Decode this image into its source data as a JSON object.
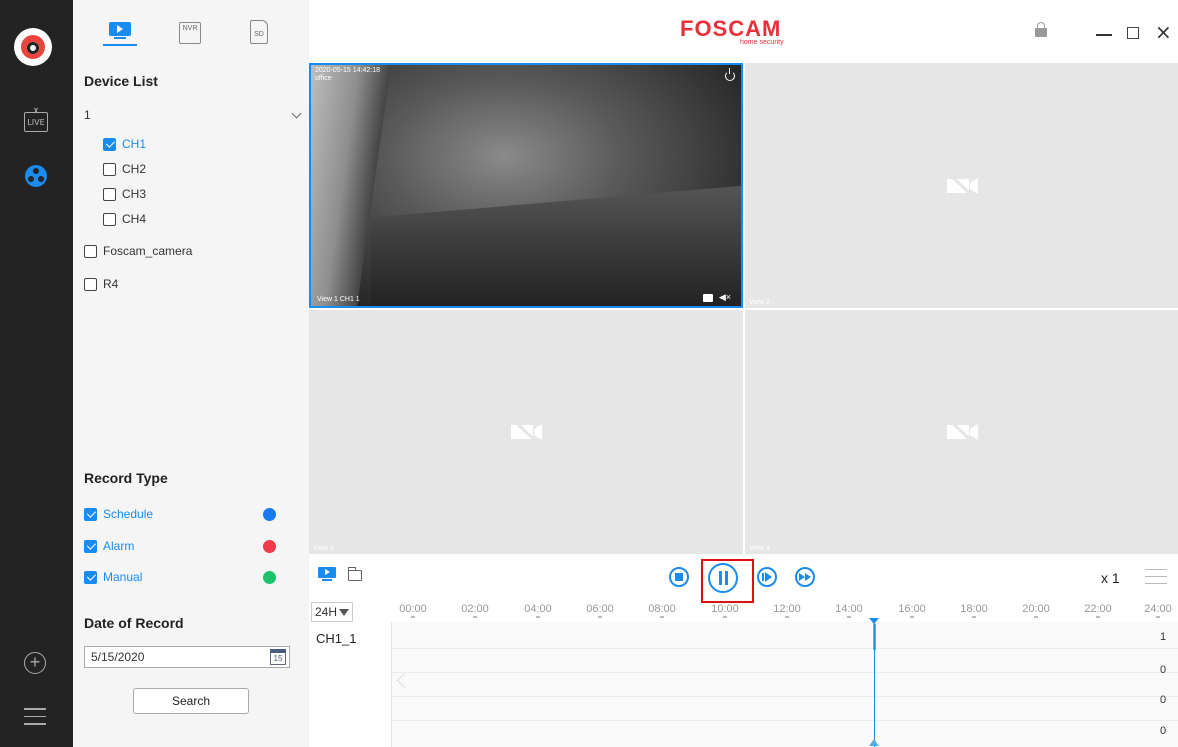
{
  "brand": {
    "name": "FOSCAM",
    "sub": "home security"
  },
  "side_tabs": {
    "nvr": "NVR",
    "sd": "SD"
  },
  "rail": {
    "live": "LIVE"
  },
  "device_list": {
    "title": "Device List",
    "selected_device": "1",
    "channels": [
      {
        "label": "CH1",
        "checked": true
      },
      {
        "label": "CH2",
        "checked": false
      },
      {
        "label": "CH3",
        "checked": false
      },
      {
        "label": "CH4",
        "checked": false
      }
    ],
    "others": [
      {
        "label": "Foscam_camera",
        "checked": false
      },
      {
        "label": "R4",
        "checked": false
      }
    ]
  },
  "record_type": {
    "title": "Record Type",
    "items": [
      {
        "label": "Schedule",
        "checked": true,
        "color": "#1a78f0"
      },
      {
        "label": "Alarm",
        "checked": true,
        "color": "#f03a4c"
      },
      {
        "label": "Manual",
        "checked": true,
        "color": "#1cc36a"
      }
    ]
  },
  "date_of_record": {
    "title": "Date of Record",
    "value": "5/15/2020",
    "calendar_day": "15",
    "search_label": "Search"
  },
  "views": {
    "view1": {
      "osd_line1": "2020-05-15 14:42:18",
      "osd_line2": "office",
      "label": "View 1   CH1 1"
    },
    "view2": {
      "label": "View 2"
    },
    "view3": {
      "label": "View 3"
    },
    "view4": {
      "label": "View 4"
    }
  },
  "controls": {
    "speed": "x 1"
  },
  "timeline": {
    "range": "24H",
    "ticks": [
      "00:00",
      "02:00",
      "04:00",
      "06:00",
      "08:00",
      "10:00",
      "12:00",
      "14:00",
      "16:00",
      "18:00",
      "20:00",
      "22:00",
      "24:00"
    ],
    "track_label": "CH1_1",
    "counts": [
      "1",
      "0",
      "0",
      "0"
    ]
  },
  "colors": {
    "accent": "#1a8cf0",
    "brand": "#e8303a",
    "highlight_box": "#e01010"
  }
}
